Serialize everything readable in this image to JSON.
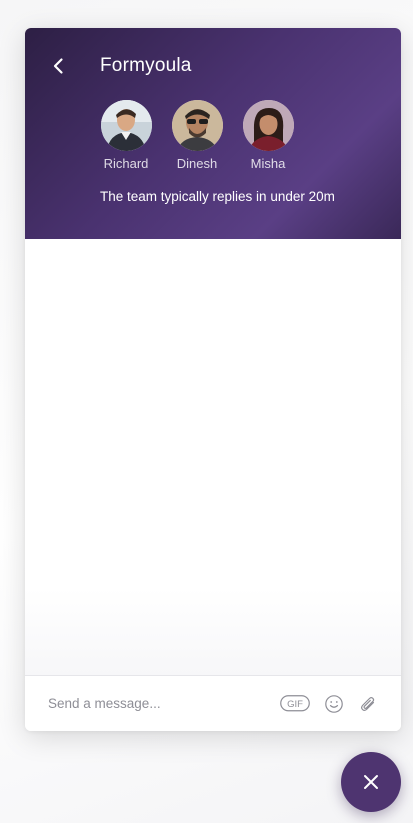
{
  "header": {
    "back_icon": "chevron-left-icon",
    "team_name": "Formyoula",
    "agents": [
      {
        "name": "Richard",
        "avatar": "avatar-photo"
      },
      {
        "name": "Dinesh",
        "avatar": "avatar-photo"
      },
      {
        "name": "Misha",
        "avatar": "avatar-photo"
      }
    ],
    "reply_time": "The team typically replies in under 20m"
  },
  "composer": {
    "placeholder": "Send a message...",
    "gif_label": "GIF",
    "emoji_icon": "smiley-icon",
    "attach_icon": "paperclip-icon"
  },
  "launcher": {
    "icon": "close-icon"
  },
  "colors": {
    "header_gradient_start": "#2d1f44",
    "header_gradient_end": "#5a3f85",
    "launcher_bg": "#4e3470"
  }
}
